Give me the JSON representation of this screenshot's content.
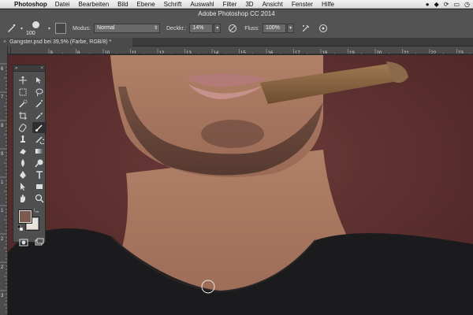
{
  "menubar": {
    "app": "Photoshop",
    "items": [
      "Datei",
      "Bearbeiten",
      "Bild",
      "Ebene",
      "Schrift",
      "Auswahl",
      "Filter",
      "3D",
      "Ansicht",
      "Fenster",
      "Hilfe"
    ]
  },
  "window": {
    "title": "Adobe Photoshop CC 2014"
  },
  "options": {
    "brush_size": "100",
    "mode_label": "Modus:",
    "mode_value": "Normal",
    "opacity_label": "Deckkr.:",
    "opacity_value": "14%",
    "flow_label": "Fluss:",
    "flow_value": "100%"
  },
  "document": {
    "tab_title": "Gangster.psd bei 39,5% (Farbe, RGB/8) *"
  },
  "ruler": {
    "h_ticks": [
      "9",
      "8",
      "10",
      "11",
      "12",
      "13",
      "14",
      "15",
      "16",
      "17",
      "18",
      "19",
      "20",
      "21",
      "22",
      "23"
    ],
    "v_ticks": [
      "6",
      "7",
      "8",
      "9",
      "1",
      "1",
      "2",
      "2",
      "3"
    ]
  },
  "colors": {
    "foreground": "#7d5a4e",
    "background": "#e7e3dc",
    "canvas_bg": "#5a2f2f"
  }
}
